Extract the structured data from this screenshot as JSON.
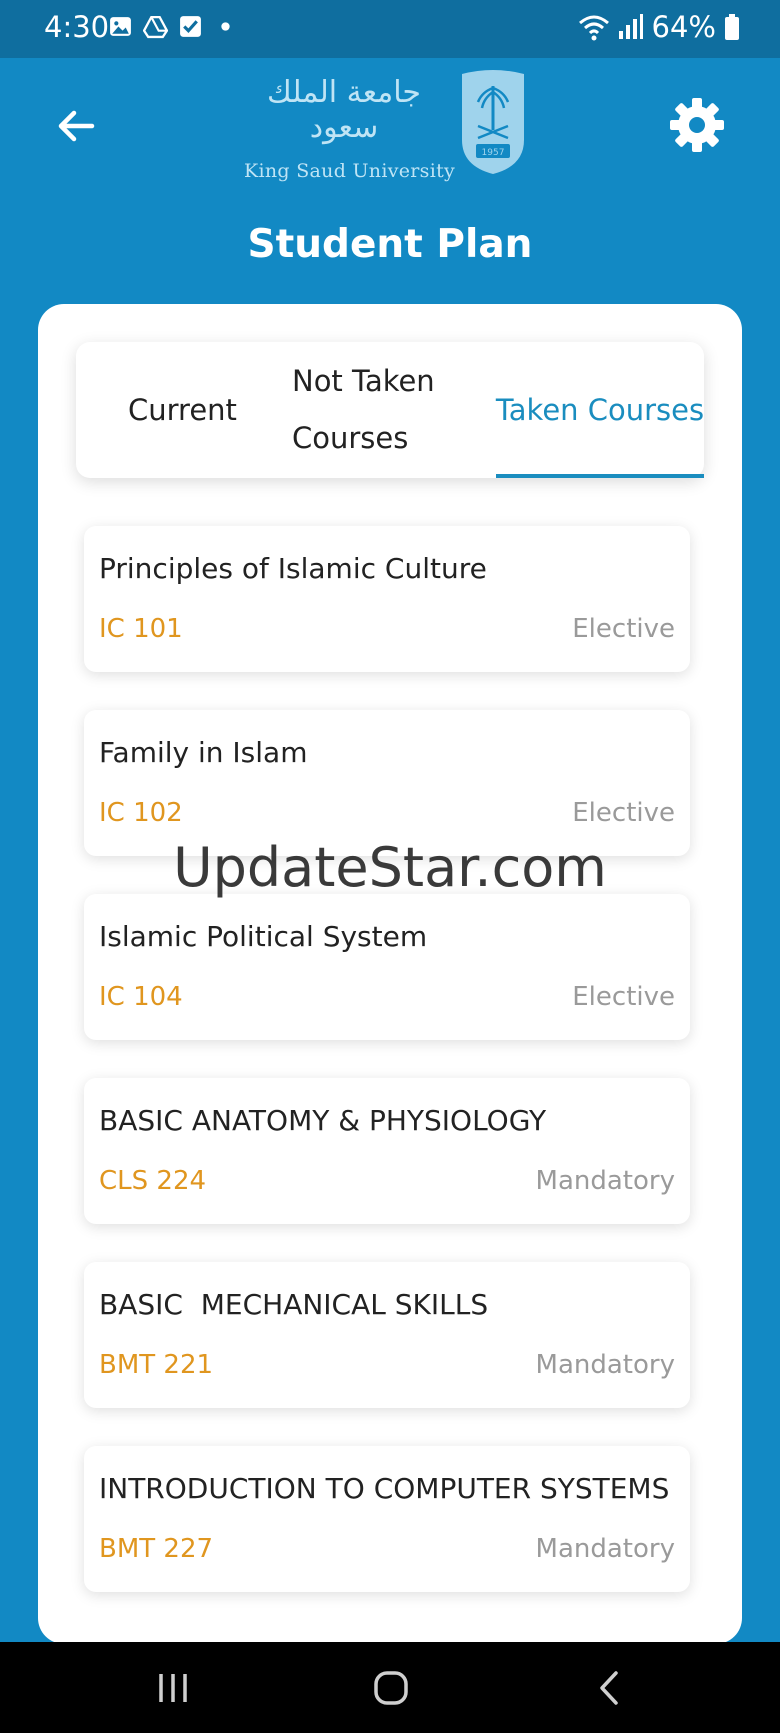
{
  "status_bar": {
    "time": "4:30",
    "battery": "64%",
    "left_icons": [
      "image-icon",
      "drive-icon",
      "checkbox-icon",
      "dot-icon"
    ],
    "right_icons": [
      "wifi-icon",
      "signal-icon",
      "battery-icon"
    ]
  },
  "header": {
    "logo_arabic": "جامعة الملك سعود",
    "logo_english": "King Saud University",
    "logo_crest_year": "1957",
    "title": "Student Plan"
  },
  "tabs": [
    {
      "label": "Current",
      "active": false
    },
    {
      "label": "Not Taken Courses",
      "active": false
    },
    {
      "label": "Taken Courses",
      "active": true
    }
  ],
  "courses": [
    {
      "name": "Principles of Islamic Culture",
      "code": "IC 101",
      "type": "Elective"
    },
    {
      "name": "Family in Islam",
      "code": "IC 102",
      "type": "Elective"
    },
    {
      "name": "Islamic Political System",
      "code": "IC 104",
      "type": "Elective"
    },
    {
      "name": "BASIC ANATOMY & PHYSIOLOGY",
      "code": "CLS 224",
      "type": "Mandatory"
    },
    {
      "name": "BASIC  MECHANICAL SKILLS",
      "code": "BMT 221",
      "type": "Mandatory"
    },
    {
      "name": "INTRODUCTION TO COMPUTER SYSTEMS",
      "code": "BMT 227",
      "type": "Mandatory"
    }
  ],
  "watermark": "UpdateStar.com",
  "colors": {
    "primary": "#1289c4",
    "status_bar": "#0f6e9f",
    "accent_tab": "#1a8dbf",
    "course_code": "#e0961f",
    "course_type": "#9a9a9a"
  }
}
